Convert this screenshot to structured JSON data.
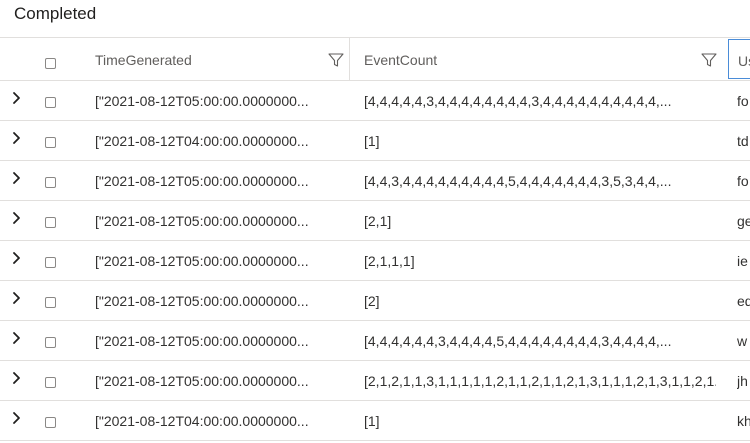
{
  "status": {
    "title": "Completed"
  },
  "columns": {
    "time_generated": "TimeGenerated",
    "event_count": "EventCount",
    "third": "Us"
  },
  "rows": [
    {
      "time": "[\"2021-08-12T05:00:00.0000000...",
      "count": "[4,4,4,4,4,3,4,4,4,4,4,4,4,4,3,4,4,4,4,4,4,4,4,4,4,...",
      "user": "fo"
    },
    {
      "time": "[\"2021-08-12T04:00:00.0000000...",
      "count": "[1]",
      "user": "td"
    },
    {
      "time": "[\"2021-08-12T05:00:00.0000000...",
      "count": "[4,4,3,4,4,4,4,4,4,4,4,4,5,4,4,4,4,4,4,4,3,5,3,4,4,...",
      "user": "fo"
    },
    {
      "time": "[\"2021-08-12T05:00:00.0000000...",
      "count": "[2,1]",
      "user": "ge"
    },
    {
      "time": "[\"2021-08-12T05:00:00.0000000...",
      "count": "[2,1,1,1]",
      "user": "ie"
    },
    {
      "time": "[\"2021-08-12T05:00:00.0000000...",
      "count": "[2]",
      "user": "ed"
    },
    {
      "time": "[\"2021-08-12T05:00:00.0000000...",
      "count": "[4,4,4,4,4,4,3,4,4,4,4,5,4,4,4,4,4,4,4,4,3,4,4,4,4,...",
      "user": "w"
    },
    {
      "time": "[\"2021-08-12T05:00:00.0000000...",
      "count": "[2,1,2,1,1,3,1,1,1,1,1,2,1,1,2,1,1,2,1,3,1,1,1,2,1,3,1,1,2,1...",
      "user": "jh"
    },
    {
      "time": "[\"2021-08-12T04:00:00.0000000...",
      "count": "[1]",
      "user": "kh"
    }
  ]
}
